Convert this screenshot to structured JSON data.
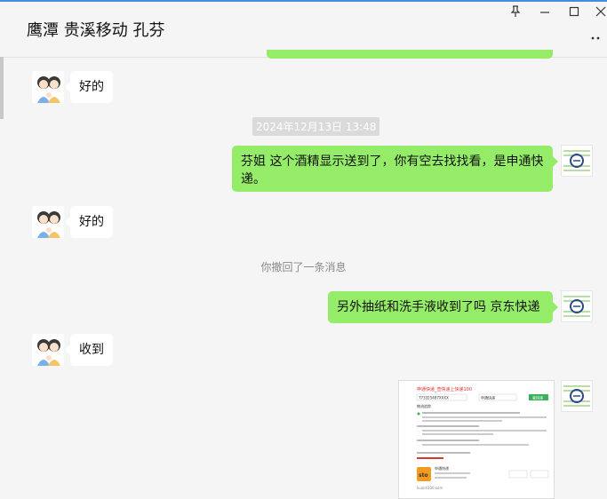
{
  "window": {
    "title": "鹰潭 贵溪移动 孔芬",
    "controls": {
      "pin": "pin-icon",
      "minimize": "minimize-icon",
      "maximize": "maximize-icon",
      "close": "close-icon",
      "more": "more-icon"
    }
  },
  "messages": [
    {
      "side": "left",
      "text": "好的"
    },
    {
      "type": "time",
      "text": "2024年12月13日 13:48"
    },
    {
      "side": "right",
      "text": "芬姐 这个酒精显示送到了，你有空去找找看，是申通快递。"
    },
    {
      "side": "left",
      "text": "好的"
    },
    {
      "type": "system",
      "text": "你撤回了一条消息"
    },
    {
      "side": "right",
      "text": "另外抽纸和洗手液收到了吗  京东快递"
    },
    {
      "side": "left",
      "text": "收到"
    },
    {
      "side": "right",
      "type": "image"
    }
  ],
  "screenshot_image": {
    "top_link": "申通快递_查快递上快递100",
    "input_value": "773325487XXXX",
    "select_value": "申通快递",
    "query_button": "查快递",
    "section_label": "物流追踪",
    "logo_text": "sto",
    "company": "申通快递",
    "footer": "kuaidi100.com"
  },
  "colors": {
    "bubble_green": "#95ec69",
    "bubble_white": "#ffffff",
    "accent": "#4a8bdc"
  }
}
